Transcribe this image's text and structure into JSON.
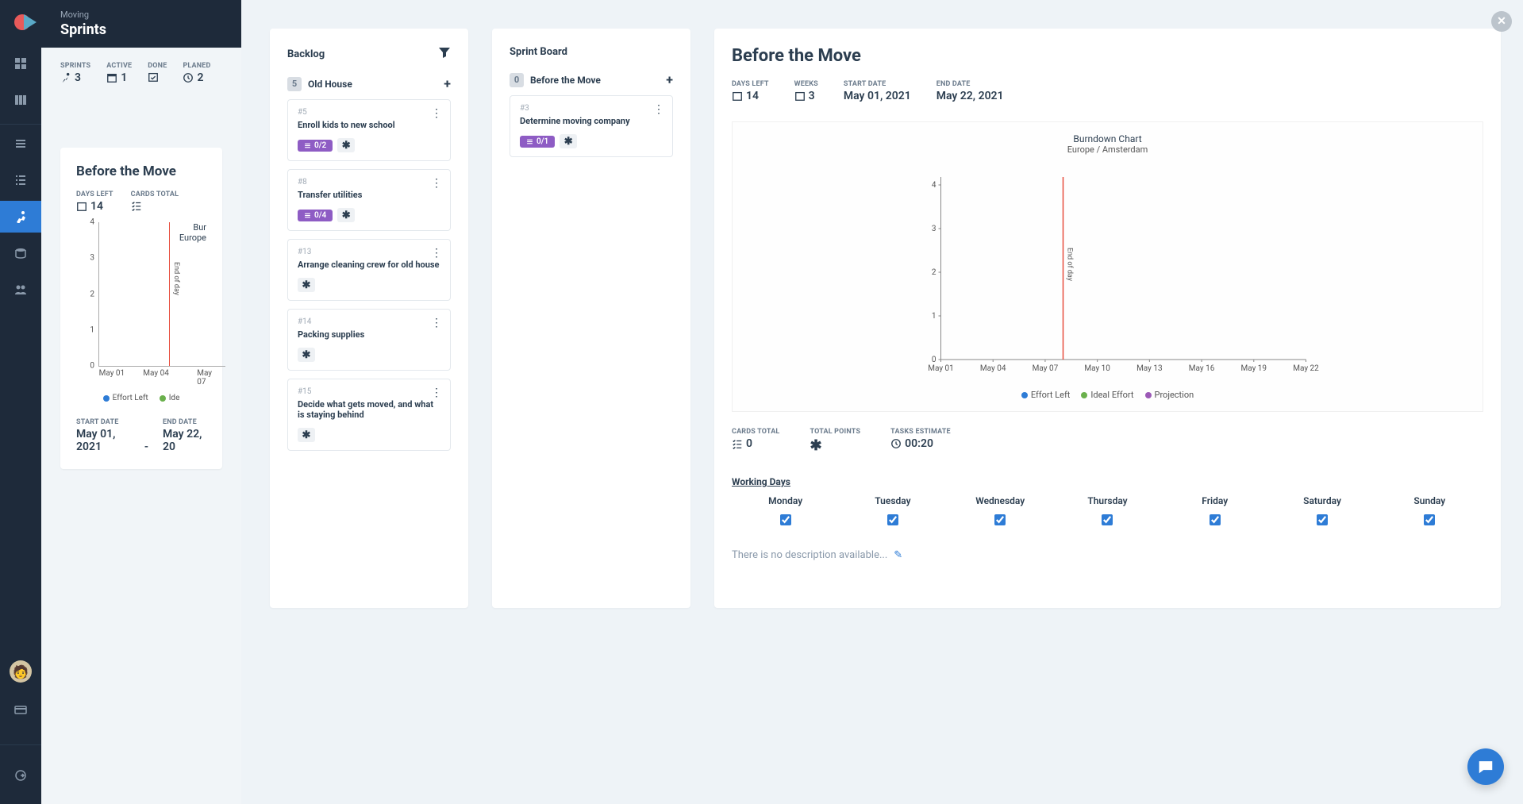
{
  "project": "Moving",
  "page": "Sprints",
  "topStats": {
    "sprints": {
      "label": "SPRINTS",
      "value": "3"
    },
    "active": {
      "label": "ACTIVE",
      "value": "1"
    },
    "done": {
      "label": "DONE",
      "value": ""
    },
    "planned": {
      "label": "PLANED",
      "value": "2"
    }
  },
  "bgCard": {
    "title": "Before the Move",
    "daysLeft": {
      "label": "DAYS LEFT",
      "value": "14"
    },
    "cardsTotal": {
      "label": "CARDS TOTAL",
      "value": ""
    },
    "miniChart": {
      "title": "Bur",
      "sub": "Europe",
      "rotLabel": "End of day"
    },
    "legend": {
      "effort": "Effort Left",
      "ideal": "Ide"
    },
    "startDate": {
      "label": "START DATE",
      "value": "May 01, 2021"
    },
    "endDate": {
      "label": "END DATE",
      "value": "May 22, 20"
    }
  },
  "backlog": {
    "title": "Backlog",
    "listName": "Old House",
    "count": "5",
    "cards": [
      {
        "id": "#5",
        "title": "Enroll kids to new school",
        "badge": "0/2"
      },
      {
        "id": "#8",
        "title": "Transfer utilities",
        "badge": "0/4"
      },
      {
        "id": "#13",
        "title": "Arrange cleaning crew for old house"
      },
      {
        "id": "#14",
        "title": "Packing supplies"
      },
      {
        "id": "#15",
        "title": "Decide what gets moved, and what is staying behind"
      }
    ]
  },
  "sprintBoard": {
    "title": "Sprint Board",
    "listName": "Before the Move",
    "count": "0",
    "cards": [
      {
        "id": "#3",
        "title": "Determine moving company",
        "badge": "0/1"
      }
    ]
  },
  "detail": {
    "title": "Before the Move",
    "stats": {
      "daysLeft": {
        "label": "DAYS LEFT",
        "value": "14"
      },
      "weeks": {
        "label": "WEEKS",
        "value": "3"
      },
      "startDate": {
        "label": "START DATE",
        "value": "May 01, 2021"
      },
      "endDate": {
        "label": "END DATE",
        "value": "May 22, 2021"
      }
    },
    "chartTitle": "Burndown Chart",
    "chartSub": "Europe / Amsterdam",
    "chartLegend": {
      "effort": "Effort Left",
      "ideal": "Ideal Effort",
      "proj": "Projection"
    },
    "bottomStats": {
      "cardsTotal": {
        "label": "CARDS TOTAL",
        "value": "0"
      },
      "totalPoints": {
        "label": "TOTAL POINTS",
        "value": ""
      },
      "tasksEstimate": {
        "label": "TASKS ESTIMATE",
        "value": "00:20"
      }
    },
    "workingDaysTitle": "Working Days",
    "days": [
      "Monday",
      "Tuesday",
      "Wednesday",
      "Thursday",
      "Friday",
      "Saturday",
      "Sunday"
    ],
    "description": "There is no description available..."
  },
  "chart_data": {
    "type": "line",
    "title": "Burndown Chart",
    "sub": "Europe / Amsterdam",
    "x": [
      "May 01",
      "May 04",
      "May 07",
      "May 10",
      "May 13",
      "May 16",
      "May 19",
      "May 22"
    ],
    "ylim": [
      0,
      4
    ],
    "yticks": [
      0,
      1,
      2,
      3,
      4
    ],
    "series": [
      {
        "name": "Effort Left",
        "color": "#2e7cd6",
        "values": []
      },
      {
        "name": "Ideal Effort",
        "color": "#6ab04c",
        "values": []
      },
      {
        "name": "Projection",
        "color": "#9b59b6",
        "values": []
      }
    ],
    "marker": {
      "label": "End of day",
      "x": "May 07.5",
      "color": "#e74c3c"
    }
  }
}
